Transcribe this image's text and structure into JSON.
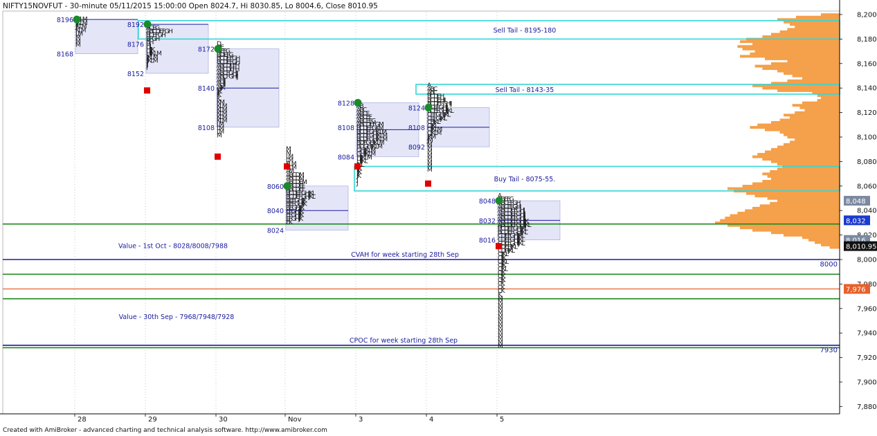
{
  "header": {
    "title": "NIFTY15NOVFUT - 30-minute 05/11/2015 15:00:00 Open 8024.7, Hi 8030.85, Lo 8004.6, Close 8010.95"
  },
  "footer": {
    "credit": "Created with AmiBroker - advanced charting and technical analysis software. http://www.amibroker.com"
  },
  "colors": {
    "background": "#ffffff",
    "value_area_fill": "#e4e6f8",
    "value_area_border": "#9aa0d8",
    "letters": "#111111",
    "tail_box": "#33d6d6",
    "green_line": "#1a8a1a",
    "blue_line": "#1a1aa0",
    "orange_line": "#e8602a",
    "volume_profile": "#f5a04a",
    "label_blue": "#1a1aa0",
    "poc_green": "#1a8a2a",
    "marker_red": "#e00000"
  },
  "chart_data": {
    "type": "market_profile",
    "y_axis": {
      "range": [
        7870,
        8210
      ],
      "ticks": [
        "8,200",
        "8,180",
        "8,160",
        "8,140",
        "8,120",
        "8,100",
        "8,080",
        "8,060",
        "8,040",
        "8,020",
        "8,000",
        "7,980",
        "7,960",
        "7,940",
        "7,920",
        "7,900",
        "7,880"
      ],
      "tick_values": [
        8200,
        8180,
        8160,
        8140,
        8120,
        8100,
        8080,
        8060,
        8040,
        8020,
        8000,
        7980,
        7960,
        7940,
        7920,
        7900,
        7880
      ],
      "price_tags": [
        {
          "text": "8,048",
          "value": 8048,
          "style": "gray"
        },
        {
          "text": "8,032",
          "value": 8032,
          "style": "blue"
        },
        {
          "text": "8,016",
          "value": 8016,
          "style": "gray"
        },
        {
          "text": "8,010.95",
          "value": 8010.95,
          "style": "black"
        },
        {
          "text": "7,976",
          "value": 7976,
          "style": "orange"
        }
      ]
    },
    "x_axis": {
      "labels": [
        "28",
        "29",
        "30",
        "Nov",
        "3",
        "4",
        "5"
      ],
      "label_slots": [
        0,
        1,
        2,
        3,
        4,
        5,
        6
      ]
    },
    "profiles": [
      {
        "day": "28",
        "high": 8198,
        "low": 8168,
        "va_high": 8196,
        "va_low": 8168,
        "poc": 8196,
        "labels": [
          "8196",
          "8168"
        ],
        "label_values": [
          8196,
          8168
        ],
        "rows": [
          "IJKLM",
          "IJKLM",
          "JKLM",
          "KLM",
          "LM",
          "M",
          "M",
          "M"
        ]
      },
      {
        "day": "29",
        "high": 8194,
        "low": 8138,
        "va_high": 8192,
        "va_low": 8152,
        "poc": 8192,
        "close": 8138,
        "labels": [
          "8192",
          "8176",
          "8152"
        ],
        "label_values": [
          8192,
          8176,
          8152
        ],
        "rows": [
          "A",
          "ACEG",
          "ABCDEFGH",
          "BCEFGH",
          "BFGH",
          "BH",
          "HI",
          "HIJK",
          "HIJKLM",
          "IJKLM",
          "IJKLM",
          "IJ",
          "I"
        ]
      },
      {
        "day": "30",
        "high": 8178,
        "low": 8070,
        "va_high": 8172,
        "va_low": 8108,
        "poc": 8140,
        "close": 8084,
        "labels": [
          "8172",
          "8140",
          "8108"
        ],
        "label_values": [
          8172,
          8140,
          8108
        ],
        "rows": [
          "D",
          "DE",
          "DEFG",
          "BDEFG",
          "BCDEFGH",
          "BCDEFGH",
          "ABCDEFH",
          "ABCDEFH",
          "ABCFGHIJ",
          "ABCFGHIJ",
          "AHIJ",
          "AHIJ",
          "AIJK",
          "IJK",
          "IK",
          "K",
          "KM",
          "KLM",
          "KLM",
          "KLM",
          "KLM",
          "KLM",
          "LM",
          "LM",
          "LM",
          "M"
        ]
      },
      {
        "day": "Nov",
        "high": 8092,
        "low": 8024,
        "va_high": 8060,
        "va_low": 8024,
        "poc": 8040,
        "close": 8076,
        "labels": [
          "8060",
          "8040",
          "8024"
        ],
        "label_values": [
          8060,
          8040,
          8024
        ],
        "rows": [
          "M",
          "M",
          "LM",
          "LM",
          "KLM",
          "ALM",
          "AM",
          "ABCDM",
          "ABCDM",
          "ABCDEM",
          "ABCDEF",
          "ABCDEF",
          "BCDEFGHJKL",
          "BCDEFGHJKL",
          "BEFGHIJK",
          "BEFGHIJK",
          "BEGHIJK",
          "EFGHIJK",
          "EFGHIJK",
          "EFGHJK",
          "EK"
        ]
      },
      {
        "day": "3",
        "high": 8130,
        "low": 8058,
        "va_high": 8128,
        "va_low": 8084,
        "poc": 8106,
        "close": 8076,
        "labels": [
          "8128",
          "8108",
          "8084"
        ],
        "label_values": [
          8128,
          8108,
          8084
        ],
        "rows": [
          "A",
          "AB",
          "ABC",
          "ABCE",
          "ABCEF",
          "ABCEFG",
          "ABCDEFGM",
          "BCDEFGKM",
          "BCDFGHKLM",
          "BCDFGHIKLM",
          "BCDFGHIKLM",
          "BDFGHIKLM",
          "BDGHIJKLM",
          "GHIJKLM",
          "GHIJKLM",
          "HIJKLM",
          "HIJKL",
          "IJKL",
          "IJK",
          "IJK",
          "JK",
          "J",
          "J"
        ]
      },
      {
        "day": "4",
        "high": 8144,
        "low": 8060,
        "va_high": 8124,
        "va_low": 8092,
        "poc": 8108,
        "close": 8062,
        "labels": [
          "8124",
          "8108",
          "8092"
        ],
        "label_values": [
          8124,
          8108,
          8092
        ],
        "rows": [
          "A",
          "ABC",
          "ABC",
          "BCDEH",
          "BCDEHIJ",
          "BCDEFGHIJ",
          "BCEFGHIJ",
          "BCEFGHIJKL",
          "CEFGHIJKL",
          "CEFGIJKL",
          "CFIJKL",
          "CIJKL",
          "CIJKLM",
          "CJKLM",
          "JKM",
          "JM",
          "M",
          "M",
          "M",
          "M",
          "M",
          "M",
          "M",
          "M"
        ]
      },
      {
        "day": "5",
        "high": 8054,
        "low": 7974,
        "va_high": 8048,
        "va_low": 8016,
        "poc": 8032,
        "close": 8010.95,
        "labels": [
          "8048",
          "8032",
          "8016"
        ],
        "label_values": [
          8048,
          8032,
          8016
        ],
        "rows": [
          "A",
          "ABEFG",
          "ABCEFGH",
          "ABCEFGHI",
          "ABCDEFGHI",
          "ABCDEFGHIJ",
          "ABCDEFGHIJ",
          "ABCDEFGHIJK",
          "ABCDEFGHIJKL",
          "BCDEFGHIJKL",
          "BCDEFGHIJKL",
          "CDEFGHIJKL",
          "CDEFGHIJKL",
          "CDEFGHIJKL",
          "CDEFIJKL",
          "CDFIJKL",
          "CIJKL",
          "CIJK",
          "CIJKL",
          "CIJK",
          "CJKL",
          "CJK",
          "CJK",
          "CJK",
          "CK",
          "CK",
          "CK",
          "K",
          "M",
          "M",
          "M",
          "M",
          "M",
          "M",
          "M",
          "M",
          "M",
          "M",
          "M",
          "M",
          "M",
          "M"
        ]
      }
    ],
    "reference_lines": [
      {
        "name": "Value - 1st Oct - 8028/8008/7988",
        "values": [
          8029,
          7988,
          7968
        ],
        "color": "green"
      },
      {
        "name": "CVAH for week starting 28th Sep",
        "value": 8000,
        "color": "blue",
        "tag": "8000"
      },
      {
        "name": "7,976",
        "value": 7976,
        "color": "orange"
      },
      {
        "name": "Value - 30th Sep -  7968/7948/7928",
        "value": 7928,
        "color": "green"
      },
      {
        "name": "CPOC for week starting 28th Sep",
        "value": 7930,
        "color": "blue",
        "tag": "7930"
      }
    ],
    "tail_boxes": [
      {
        "label": "Sell Tail - 8195-180",
        "high": 8195,
        "low": 8180
      },
      {
        "label": "Sell Tail - 8143-35",
        "high": 8143,
        "low": 8135
      },
      {
        "label": "Buy Tail - 8075-55.",
        "high": 8076,
        "low": 8056
      }
    ],
    "annotations": [
      {
        "text": "Value - 1st Oct - 8028/8008/7988",
        "value": 8011
      },
      {
        "text": "CVAH for week starting 28th Sep",
        "value": 8004
      },
      {
        "text": "Value - 30th Sep -  7968/7948/7928",
        "value": 7953
      },
      {
        "text": "CPOC for week starting 28th Sep",
        "value": 7934
      }
    ],
    "volume_profile": [
      {
        "p": 8200,
        "v": 0.15
      },
      {
        "p": 8198,
        "v": 0.35
      },
      {
        "p": 8196,
        "v": 0.5
      },
      {
        "p": 8194,
        "v": 0.45
      },
      {
        "p": 8192,
        "v": 0.4
      },
      {
        "p": 8190,
        "v": 0.36
      },
      {
        "p": 8188,
        "v": 0.42
      },
      {
        "p": 8186,
        "v": 0.48
      },
      {
        "p": 8184,
        "v": 0.55
      },
      {
        "p": 8182,
        "v": 0.62
      },
      {
        "p": 8180,
        "v": 0.75
      },
      {
        "p": 8178,
        "v": 0.8
      },
      {
        "p": 8176,
        "v": 0.7
      },
      {
        "p": 8174,
        "v": 0.82
      },
      {
        "p": 8172,
        "v": 0.78
      },
      {
        "p": 8170,
        "v": 0.68
      },
      {
        "p": 8168,
        "v": 0.72
      },
      {
        "p": 8166,
        "v": 0.8
      },
      {
        "p": 8164,
        "v": 0.6
      },
      {
        "p": 8162,
        "v": 0.42
      },
      {
        "p": 8160,
        "v": 0.55
      },
      {
        "p": 8158,
        "v": 0.68
      },
      {
        "p": 8156,
        "v": 0.62
      },
      {
        "p": 8154,
        "v": 0.5
      },
      {
        "p": 8152,
        "v": 0.45
      },
      {
        "p": 8150,
        "v": 0.38
      },
      {
        "p": 8148,
        "v": 0.3
      },
      {
        "p": 8146,
        "v": 0.42
      },
      {
        "p": 8144,
        "v": 0.55
      },
      {
        "p": 8142,
        "v": 0.7
      },
      {
        "p": 8140,
        "v": 0.62
      },
      {
        "p": 8138,
        "v": 0.5
      },
      {
        "p": 8136,
        "v": 0.22
      },
      {
        "p": 8134,
        "v": 0.18
      },
      {
        "p": 8132,
        "v": 0.15
      },
      {
        "p": 8130,
        "v": 0.18
      },
      {
        "p": 8128,
        "v": 0.3
      },
      {
        "p": 8126,
        "v": 0.38
      },
      {
        "p": 8124,
        "v": 0.32
      },
      {
        "p": 8122,
        "v": 0.28
      },
      {
        "p": 8120,
        "v": 0.36
      },
      {
        "p": 8118,
        "v": 0.45
      },
      {
        "p": 8116,
        "v": 0.4
      },
      {
        "p": 8114,
        "v": 0.48
      },
      {
        "p": 8112,
        "v": 0.55
      },
      {
        "p": 8110,
        "v": 0.66
      },
      {
        "p": 8108,
        "v": 0.72
      },
      {
        "p": 8106,
        "v": 0.6
      },
      {
        "p": 8104,
        "v": 0.48
      },
      {
        "p": 8102,
        "v": 0.45
      },
      {
        "p": 8100,
        "v": 0.42
      },
      {
        "p": 8098,
        "v": 0.36
      },
      {
        "p": 8096,
        "v": 0.4
      },
      {
        "p": 8094,
        "v": 0.45
      },
      {
        "p": 8092,
        "v": 0.5
      },
      {
        "p": 8090,
        "v": 0.55
      },
      {
        "p": 8088,
        "v": 0.6
      },
      {
        "p": 8086,
        "v": 0.66
      },
      {
        "p": 8084,
        "v": 0.7
      },
      {
        "p": 8082,
        "v": 0.62
      },
      {
        "p": 8080,
        "v": 0.55
      },
      {
        "p": 8078,
        "v": 0.5
      },
      {
        "p": 8076,
        "v": 0.46
      },
      {
        "p": 8074,
        "v": 0.5
      },
      {
        "p": 8072,
        "v": 0.56
      },
      {
        "p": 8070,
        "v": 0.62
      },
      {
        "p": 8068,
        "v": 0.58
      },
      {
        "p": 8066,
        "v": 0.55
      },
      {
        "p": 8064,
        "v": 0.62
      },
      {
        "p": 8062,
        "v": 0.7
      },
      {
        "p": 8060,
        "v": 0.78
      },
      {
        "p": 8058,
        "v": 0.9
      },
      {
        "p": 8056,
        "v": 0.85
      },
      {
        "p": 8054,
        "v": 0.75
      },
      {
        "p": 8052,
        "v": 0.68
      },
      {
        "p": 8050,
        "v": 0.58
      },
      {
        "p": 8048,
        "v": 0.5
      },
      {
        "p": 8046,
        "v": 0.56
      },
      {
        "p": 8044,
        "v": 0.64
      },
      {
        "p": 8042,
        "v": 0.7
      },
      {
        "p": 8040,
        "v": 0.76
      },
      {
        "p": 8038,
        "v": 0.82
      },
      {
        "p": 8036,
        "v": 0.88
      },
      {
        "p": 8034,
        "v": 0.92
      },
      {
        "p": 8032,
        "v": 0.96
      },
      {
        "p": 8030,
        "v": 1.0
      },
      {
        "p": 8028,
        "v": 0.9
      },
      {
        "p": 8026,
        "v": 0.8
      },
      {
        "p": 8024,
        "v": 0.7
      },
      {
        "p": 8022,
        "v": 0.55
      },
      {
        "p": 8020,
        "v": 0.45
      },
      {
        "p": 8018,
        "v": 0.3
      },
      {
        "p": 8016,
        "v": 0.25
      },
      {
        "p": 8014,
        "v": 0.2
      },
      {
        "p": 8012,
        "v": 0.15
      },
      {
        "p": 8010,
        "v": 0.08
      }
    ]
  }
}
